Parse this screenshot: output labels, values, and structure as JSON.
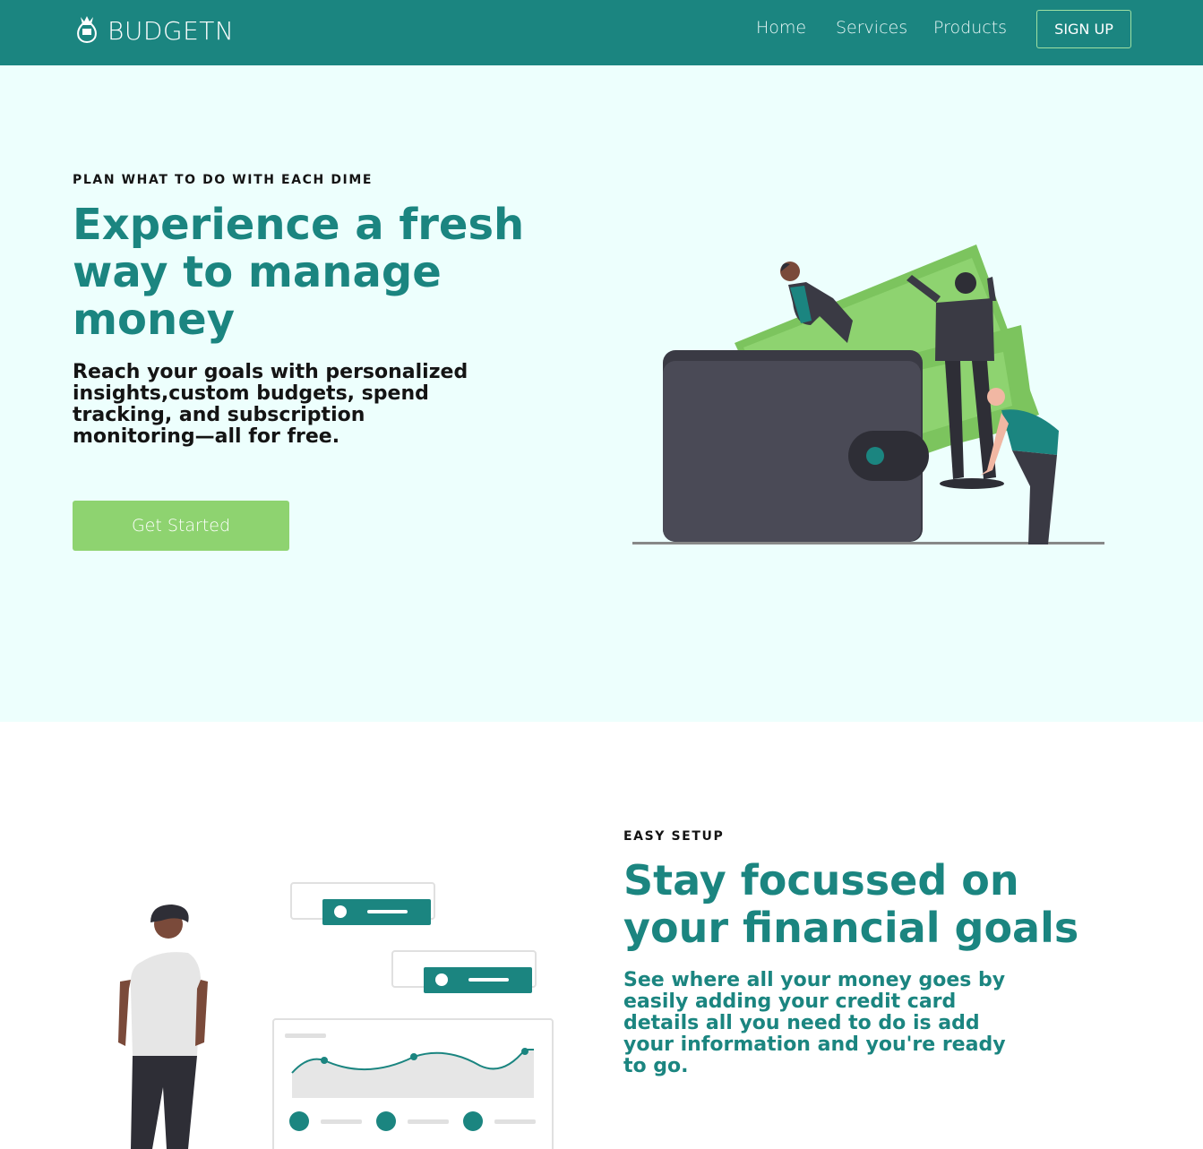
{
  "nav": {
    "brand": "BUDGETN",
    "links": [
      "Home",
      "Services",
      "Products"
    ],
    "signup": "SIGN UP"
  },
  "hero": {
    "eyebrow": "PLAN WHAT TO DO WITH EACH DIME",
    "title": "Experience a fresh way to manage money",
    "subtitle": "Reach your goals with personalized insights,custom budgets, spend tracking, and subscription monitoring—all for free.",
    "cta": "Get Started"
  },
  "setup": {
    "eyebrow": "EASY SETUP",
    "title": "Stay focussed on your financial goals",
    "text": "See where all your money goes by easily adding your credit card details all you need to do is add your information and you're ready to go."
  },
  "colors": {
    "brand": "#1b8580",
    "accent_green": "#8ed370",
    "hero_bg": "#edfffd",
    "text_dark": "#141414"
  },
  "icons": [
    "money-bag-logo-icon"
  ]
}
